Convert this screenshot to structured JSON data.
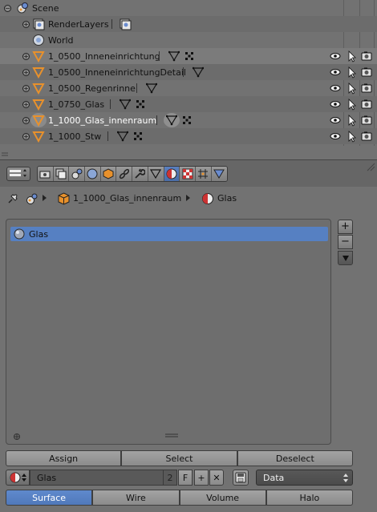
{
  "outliner": {
    "scene_label": "Scene",
    "renderlayers_label": "RenderLayers",
    "world_label": "World",
    "objects": [
      {
        "label": "1_0500_Inneneinrichtung"
      },
      {
        "label": "1_0500_InneneinrichtungDetail"
      },
      {
        "label": "1_0500_Regenrinne"
      },
      {
        "label": "1_0750_Glas"
      },
      {
        "label": "1_1000_Glas_innenraum"
      },
      {
        "label": "1_1000_Stw"
      }
    ]
  },
  "context": {
    "object_label": "1_1000_Glas_innenraum",
    "material_label": "Glas"
  },
  "slot_list": {
    "items": [
      {
        "label": "Glas"
      }
    ],
    "add_label": "+",
    "remove_label": "−"
  },
  "assign_row": {
    "assign_label": "Assign",
    "select_label": "Select",
    "deselect_label": "Deselect"
  },
  "material": {
    "name": "Glas",
    "users": "2",
    "fake_user_label": "F",
    "new_label": "+",
    "unlink_label": "✕",
    "link_type": "Data"
  },
  "preview_tabs": {
    "surface_label": "Surface",
    "wire_label": "Wire",
    "volume_label": "Volume",
    "halo_label": "Halo"
  },
  "colors": {
    "selected_blue": "#5680c2",
    "mesh_orange": "#e8912c"
  }
}
